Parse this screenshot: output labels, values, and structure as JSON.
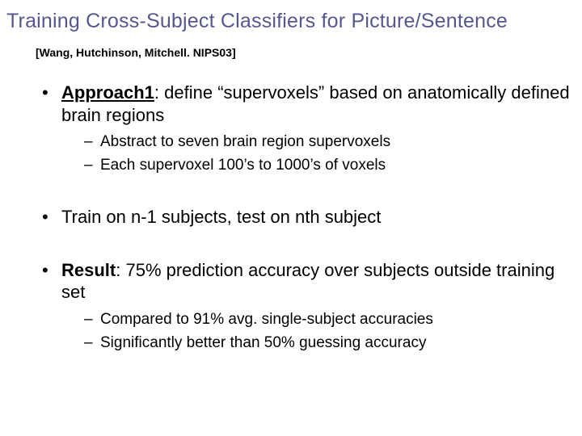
{
  "title": "Training Cross-Subject Classifiers for Picture/Sentence",
  "citation": "[Wang, Hutchinson, Mitchell. NIPS03]",
  "bullet1_lead": "Approach1",
  "bullet1_rest": ": define “supervoxels” based on anatomically defined brain regions",
  "sub1a": "Abstract to seven brain region supervoxels",
  "sub1b": "Each supervoxel 100’s to 1000’s of voxels",
  "bullet2": "Train on n-1 subjects, test on nth subject",
  "bullet3_lead": "Result",
  "bullet3_rest": ": 75% prediction accuracy over subjects outside training set",
  "sub3a": "Compared to 91% avg. single-subject accuracies",
  "sub3b": "Significantly better than 50% guessing accuracy"
}
